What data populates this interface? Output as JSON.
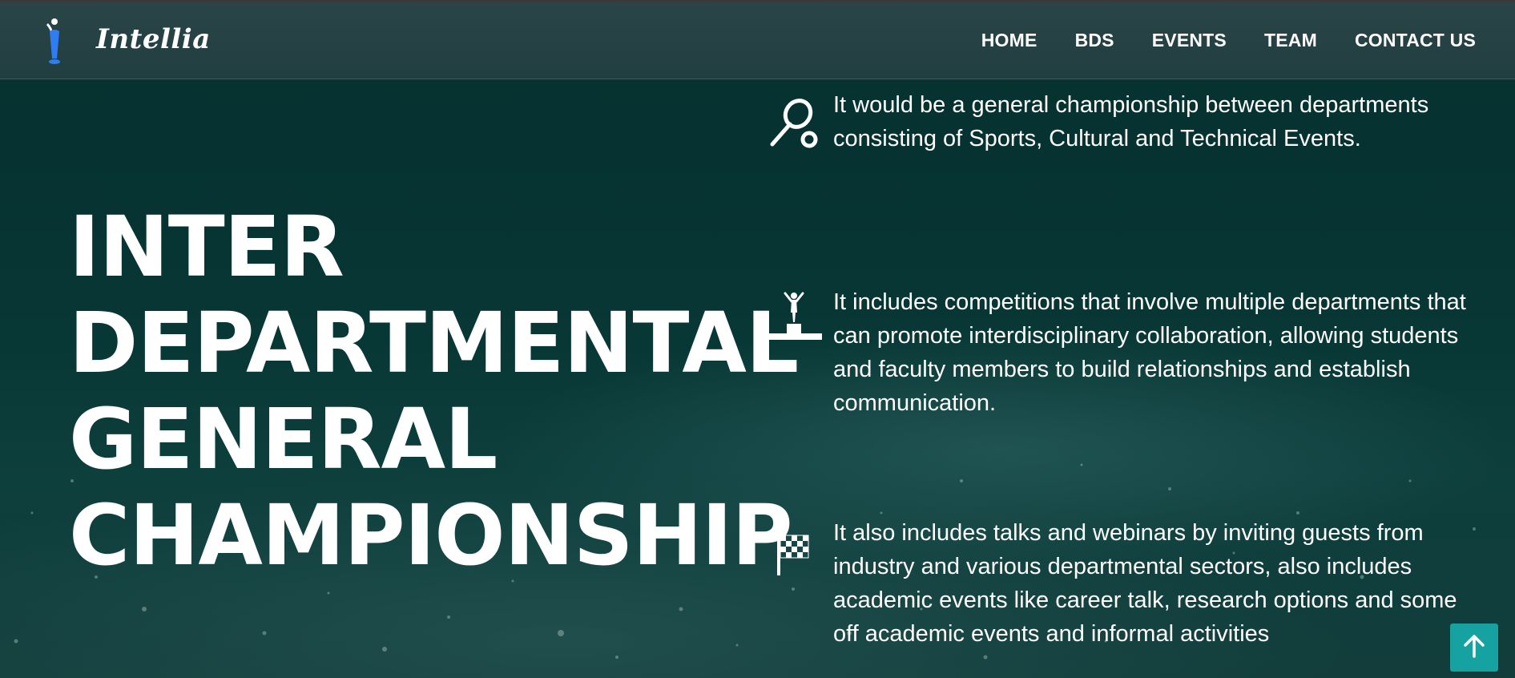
{
  "brand": {
    "name": "Intellia"
  },
  "nav": {
    "items": [
      {
        "label": "HOME"
      },
      {
        "label": "BDS"
      },
      {
        "label": "EVENTS"
      },
      {
        "label": "TEAM"
      },
      {
        "label": "CONTACT US"
      }
    ]
  },
  "hero": {
    "title_lines": [
      "INTER",
      "DEPARTMENTAL",
      "GENERAL",
      "CHAMPIONSHIP"
    ]
  },
  "features": [
    {
      "icon": "tennis-racket-icon",
      "text": "It would be a general championship between departments consisting of Sports, Cultural and Technical Events."
    },
    {
      "icon": "podium-icon",
      "text": "It includes competitions that involve multiple departments that can promote interdisciplinary collaboration, allowing students and faculty members to build relationships and establish communication."
    },
    {
      "icon": "checkered-flag-icon",
      "text": "It also includes talks and webinars by inviting guests from industry and various departmental sectors, also includes academic events like career talk, research options and some off academic events and informal activities"
    }
  ],
  "back_to_top": {
    "icon": "arrow-up-icon"
  },
  "colors": {
    "accent": "#17a2a2",
    "navbar": "#213e40",
    "background": "#073634",
    "logo_blue": "#2e7df2"
  }
}
